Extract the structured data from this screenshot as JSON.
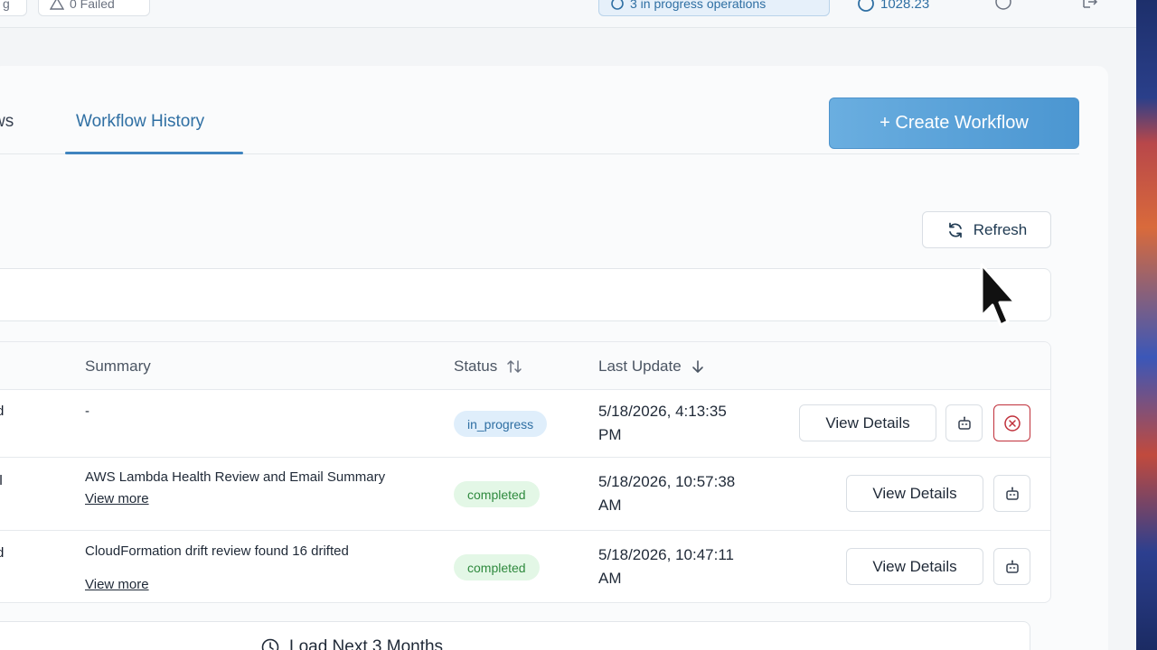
{
  "topbar": {
    "first_pill": "g",
    "failed_label": "0 Failed",
    "ops_label": "3 in progress operations",
    "credits": "1028.23"
  },
  "tabs": [
    {
      "label": "ws"
    },
    {
      "label": "Workflow History"
    }
  ],
  "actions": {
    "create_label": "+ Create Workflow",
    "refresh_label": "Refresh"
  },
  "table": {
    "columns": {
      "summary": "Summary",
      "status": "Status",
      "last_update": "Last Update"
    },
    "rows": [
      {
        "name_fragment": "d",
        "summary": "-",
        "view_more": "",
        "status": "in_progress",
        "date_line1": "5/18/2026, 4:13:35",
        "date_line2": "PM",
        "view_label": "View Details"
      },
      {
        "name_fragment": "il",
        "summary": "AWS Lambda Health Review and Email Summary",
        "view_more": "View more",
        "status": "completed",
        "date_line1": "5/18/2026, 10:57:38",
        "date_line2": "AM",
        "view_label": "View Details"
      },
      {
        "name_fragment": "d",
        "summary": "CloudFormation drift review found 16 drifted",
        "view_more": "View more",
        "status": "completed",
        "date_line1": "5/18/2026, 10:47:11",
        "date_line2": "AM",
        "view_label": "View Details"
      }
    ]
  },
  "load_more_label": "Load Next 3 Months",
  "colors": {
    "accent": "#3f84bf",
    "progress_badge": "#dfeefb",
    "completed_badge": "#e3f7e6",
    "danger": "#c0303b"
  }
}
